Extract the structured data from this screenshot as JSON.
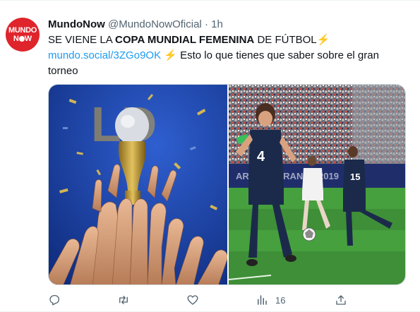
{
  "tweet": {
    "name": "MundoNow",
    "handle": "@MundoNowOficial",
    "separator": "·",
    "time": "1h",
    "avatar_line1": "MUNDO",
    "avatar_line2a": "N",
    "avatar_line2b": "W",
    "text_part1": "SE VIENE LA ",
    "text_bold": "COPA MUNDIAL FEMENINA",
    "text_part2": " DE FÚTBOL",
    "bolt": "⚡",
    "link": "mundo.social/3ZGo9OK",
    "text_part3": " Esto lo que tienes que saber sobre el gran torneo",
    "views": "16",
    "colors": {
      "brand": "#e0242c",
      "link": "#1d9bf0",
      "muted": "#536471",
      "pitch": "#3e8f37",
      "jersey_navy": "#1b2a4a",
      "stage_blue": "#1c3f9e"
    },
    "icons": [
      "reply-icon",
      "retweet-icon",
      "like-icon",
      "views-icon",
      "share-icon",
      "more-icon"
    ]
  }
}
